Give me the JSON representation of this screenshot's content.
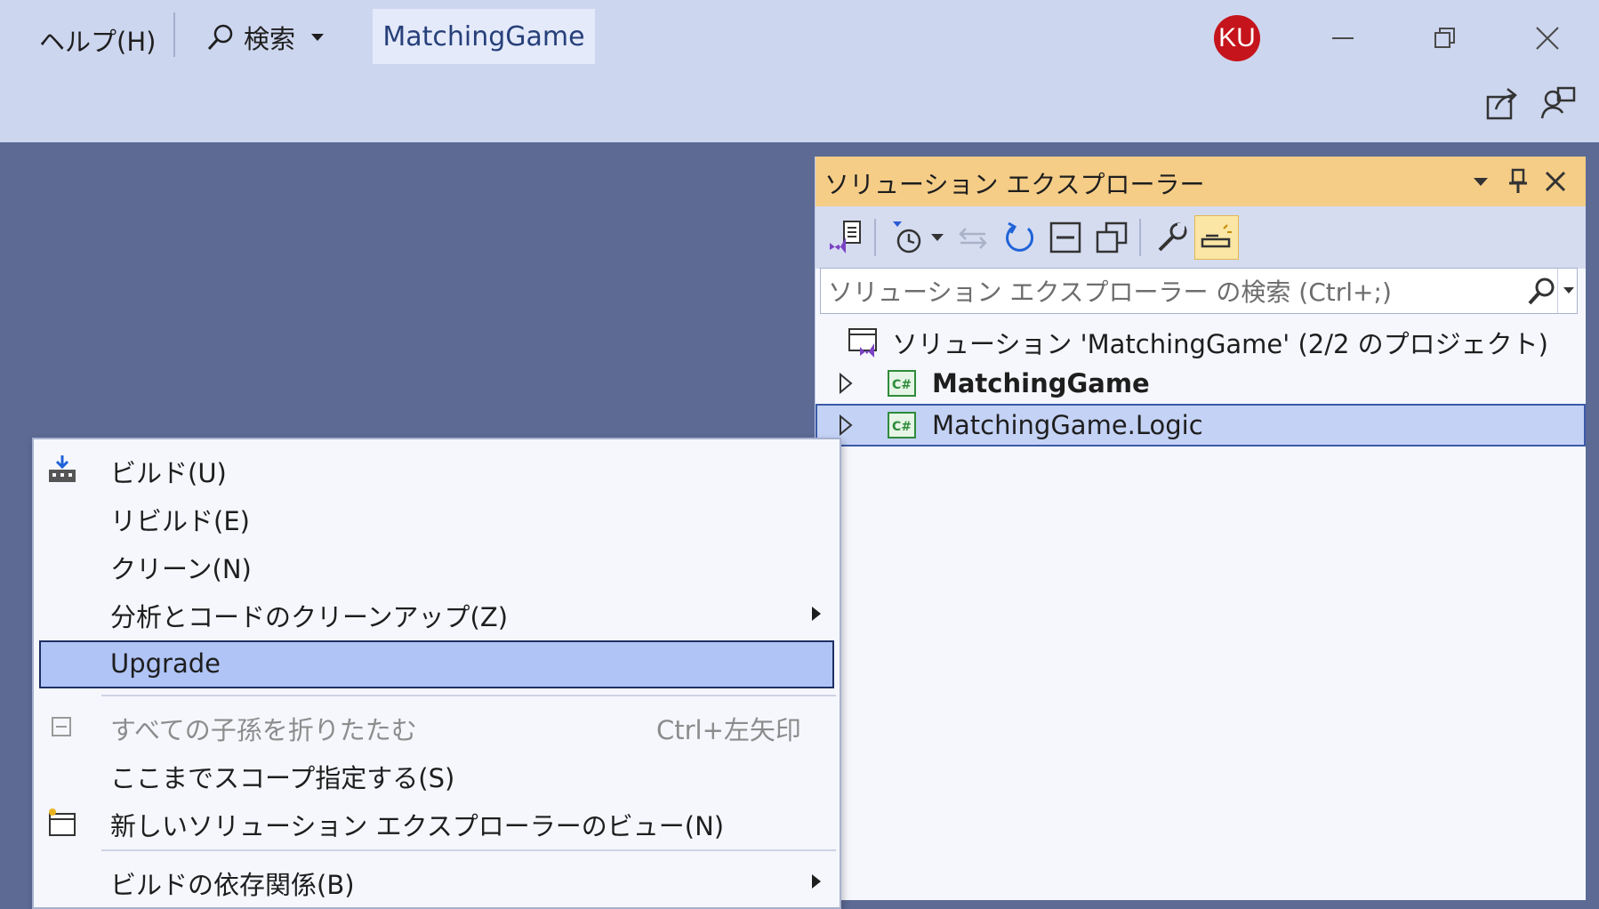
{
  "titlebar": {
    "menu_help": "ヘルプ(H)",
    "search_label": "検索",
    "title": "MatchingGame",
    "avatar_initials": "KU",
    "avatar_color": "#c5141c"
  },
  "solution_explorer": {
    "title": "ソリューション エクスプローラー",
    "search_placeholder": "ソリューション エクスプローラー の検索 (Ctrl+;)",
    "tree": [
      {
        "label": "ソリューション 'MatchingGame' (2/2 のプロジェクト)",
        "icon": "solution-icon"
      },
      {
        "label": "MatchingGame",
        "icon": "csharp-project-icon",
        "bold": true
      },
      {
        "label": "MatchingGame.Logic",
        "icon": "csharp-project-icon",
        "selected": true
      }
    ],
    "header_color": "#f5cd87"
  },
  "context_menu": {
    "items": [
      {
        "label": "ビルド(U)",
        "icon": "build-icon"
      },
      {
        "label": "リビルド(E)"
      },
      {
        "label": "クリーン(N)"
      },
      {
        "label": "分析とコードのクリーンアップ(Z)",
        "submenu": true
      },
      {
        "label": "Upgrade",
        "highlighted": true
      },
      {
        "label": "すべての子孫を折りたたむ",
        "shortcut": "Ctrl+左矢印",
        "disabled": true,
        "icon": "collapse-icon"
      },
      {
        "label": "ここまでスコープ指定する(S)"
      },
      {
        "label": "新しいソリューション エクスプローラーのビュー(N)",
        "icon": "new-view-icon"
      },
      {
        "label": "ビルドの依存関係(B)",
        "submenu": true
      }
    ],
    "highlight_color": "#b0c4f6"
  }
}
